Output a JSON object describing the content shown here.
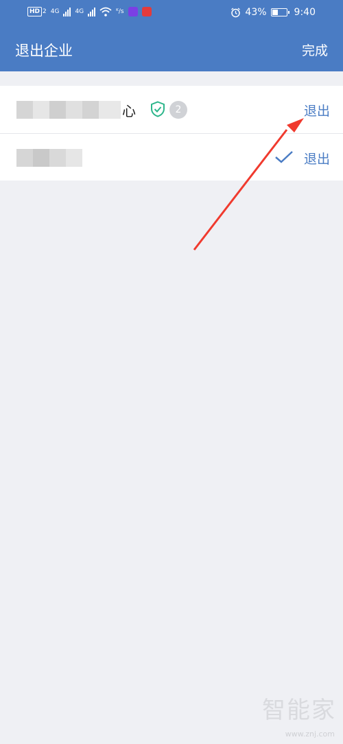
{
  "status_bar": {
    "hd_label": "HD",
    "sim_label": "2",
    "net1_label": "4G",
    "net2_label": "4G",
    "speed_label": "ᴷ/s",
    "battery_percent": "43%",
    "battery_level": 43,
    "time": "9:40"
  },
  "header": {
    "title": "退出企业",
    "done_label": "完成"
  },
  "organizations": [
    {
      "name_visible": "心",
      "badge_count": "2",
      "exit_label": "退出",
      "verified": true,
      "is_current": false
    },
    {
      "exit_label": "退出",
      "verified": false,
      "is_current": true
    }
  ],
  "watermark": {
    "text": "智能家",
    "url": "www.znj.com"
  },
  "colors": {
    "brand_blue": "#4a7cc4",
    "background": "#eff0f4",
    "verified_green": "#2bb58a",
    "badge_gray": "#d0d2d6",
    "annotation_red": "#f03a2e"
  }
}
